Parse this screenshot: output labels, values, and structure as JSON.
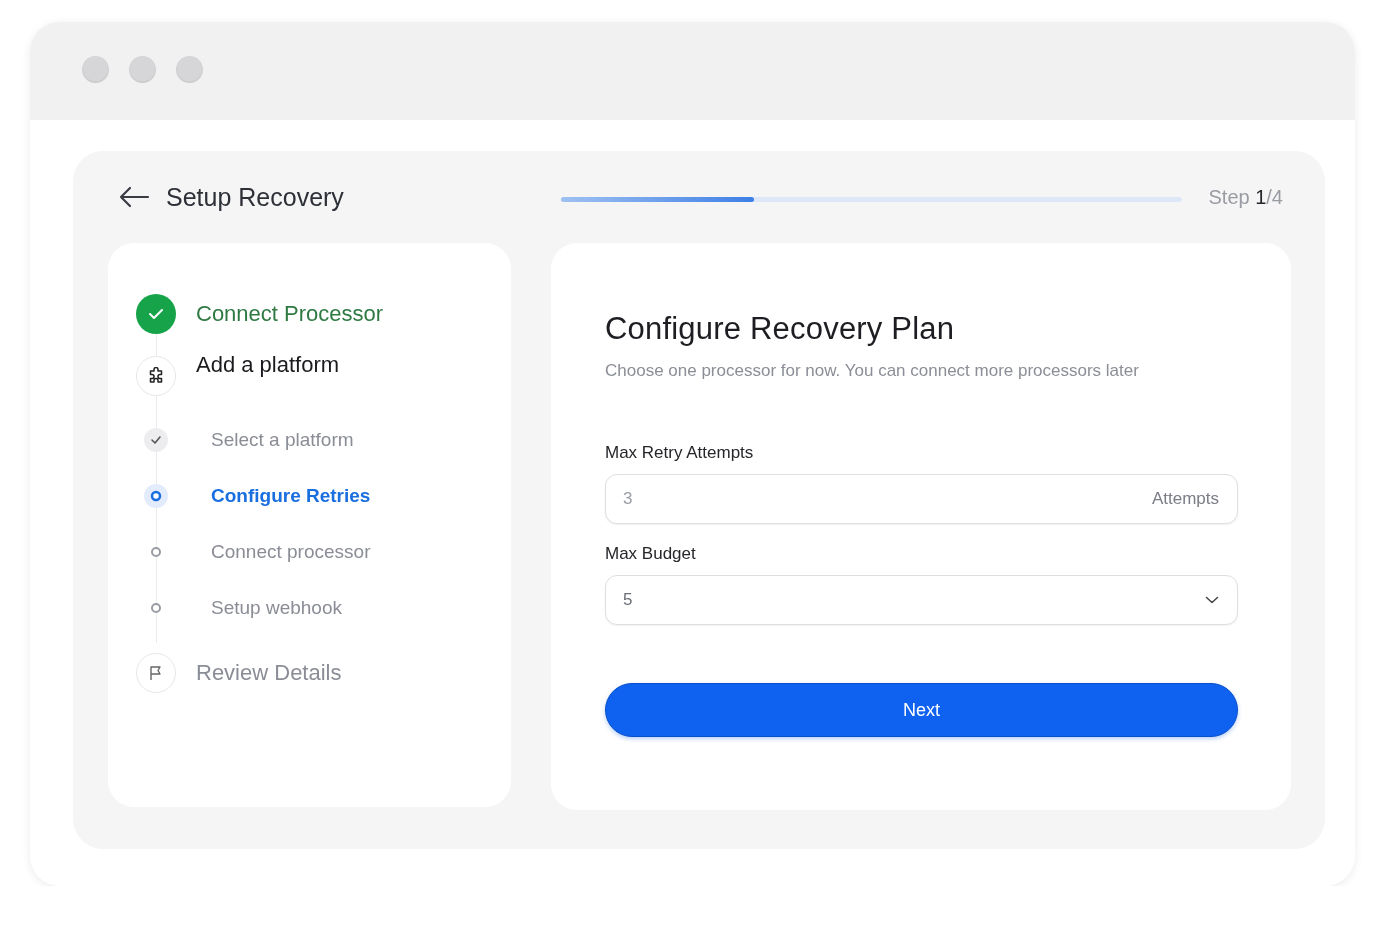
{
  "header": {
    "title": "Setup Recovery",
    "progress": {
      "level": 0.31
    },
    "step_indicator": "Step **1**/4"
  },
  "steps": [
    {
      "label": "Connect Processor",
      "completed": true,
      "selected": false
    },
    {
      "label": "Add a platform",
      "completed": false,
      "selected": true,
      "children": [
        {
          "label": "Select a platform",
          "completed": true,
          "selected": false
        },
        {
          "label": "Configure Retries",
          "completed": false,
          "selected": true
        },
        {
          "label": "Connect processor",
          "completed": false,
          "selected": false
        },
        {
          "label": "Setup webhook",
          "completed": false,
          "selected": false
        }
      ]
    },
    {
      "label": "Review Details",
      "completed": false,
      "selected": false
    }
  ],
  "form": {
    "title": "Configure Recovery Plan",
    "subtitle": "Choose one processor for now. You can connect more processors later",
    "fields": [
      {
        "kind": "number",
        "label": "Max Retry Attempts",
        "placeholder": "3",
        "suffix": "Attempts"
      },
      {
        "kind": "select",
        "label": "Max Budget",
        "value": "5"
      }
    ],
    "button": "Next"
  }
}
